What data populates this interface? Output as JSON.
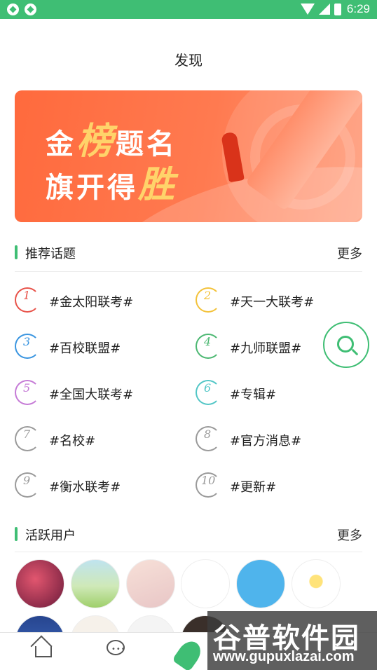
{
  "status_bar": {
    "time": "6:29"
  },
  "header": {
    "title": "发现"
  },
  "banner": {
    "line1_a": "金",
    "line1_hl": "榜",
    "line1_b": "题名",
    "line2_a": "旗开得",
    "line2_hl": "胜"
  },
  "topics_section": {
    "title": "推荐话题",
    "more": "更多"
  },
  "topics": [
    {
      "num": "1",
      "label": "#金太阳联考#",
      "color": "#e8534a"
    },
    {
      "num": "2",
      "label": "#天一大联考#",
      "color": "#f3c23a"
    },
    {
      "num": "3",
      "label": "#百校联盟#",
      "color": "#3a95e0"
    },
    {
      "num": "4",
      "label": "#九师联盟#",
      "color": "#4cb872"
    },
    {
      "num": "5",
      "label": "#全国大联考#",
      "color": "#c57ad6"
    },
    {
      "num": "6",
      "label": "#专辑#",
      "color": "#52c6c6"
    },
    {
      "num": "7",
      "label": "#名校#",
      "color": "#9a9a9a"
    },
    {
      "num": "8",
      "label": "#官方消息#",
      "color": "#9a9a9a"
    },
    {
      "num": "9",
      "label": "#衡水联考#",
      "color": "#9a9a9a"
    },
    {
      "num": "10",
      "label": "#更新#",
      "color": "#9a9a9a"
    }
  ],
  "users_section": {
    "title": "活跃用户",
    "more": "更多"
  },
  "watermark": {
    "big": "谷普软件园",
    "small": "www.gupuxlazai.com"
  }
}
